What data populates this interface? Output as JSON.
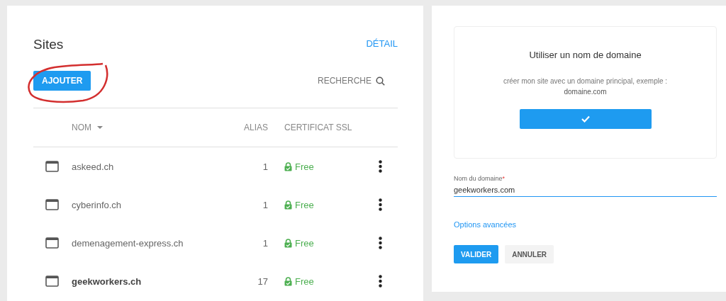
{
  "sites_panel": {
    "title": "Sites",
    "detail_link": "DÉTAIL",
    "add_button": "AJOUTER",
    "search_label": "RECHERCHE",
    "columns": {
      "name": "NOM",
      "alias": "ALIAS",
      "ssl": "CERTIFICAT SSL"
    },
    "rows": [
      {
        "name": "askeed.ch",
        "alias": "1",
        "ssl": "Free",
        "selected": false
      },
      {
        "name": "cyberinfo.ch",
        "alias": "1",
        "ssl": "Free",
        "selected": false
      },
      {
        "name": "demenagement-express.ch",
        "alias": "1",
        "ssl": "Free",
        "selected": false
      },
      {
        "name": "geekworkers.ch",
        "alias": "17",
        "ssl": "Free",
        "selected": true
      }
    ]
  },
  "domain_panel": {
    "option_title": "Utiliser un nom de domaine",
    "option_description": "créer mon site avec un domaine principal, exemple :",
    "option_example": "domaine.com",
    "field_label": "Nom du domaine",
    "required_mark": "*",
    "field_value": "geekworkers.com",
    "advanced_link": "Options avancées",
    "buttons": [
      "VALIDER",
      "ANNULER"
    ]
  }
}
